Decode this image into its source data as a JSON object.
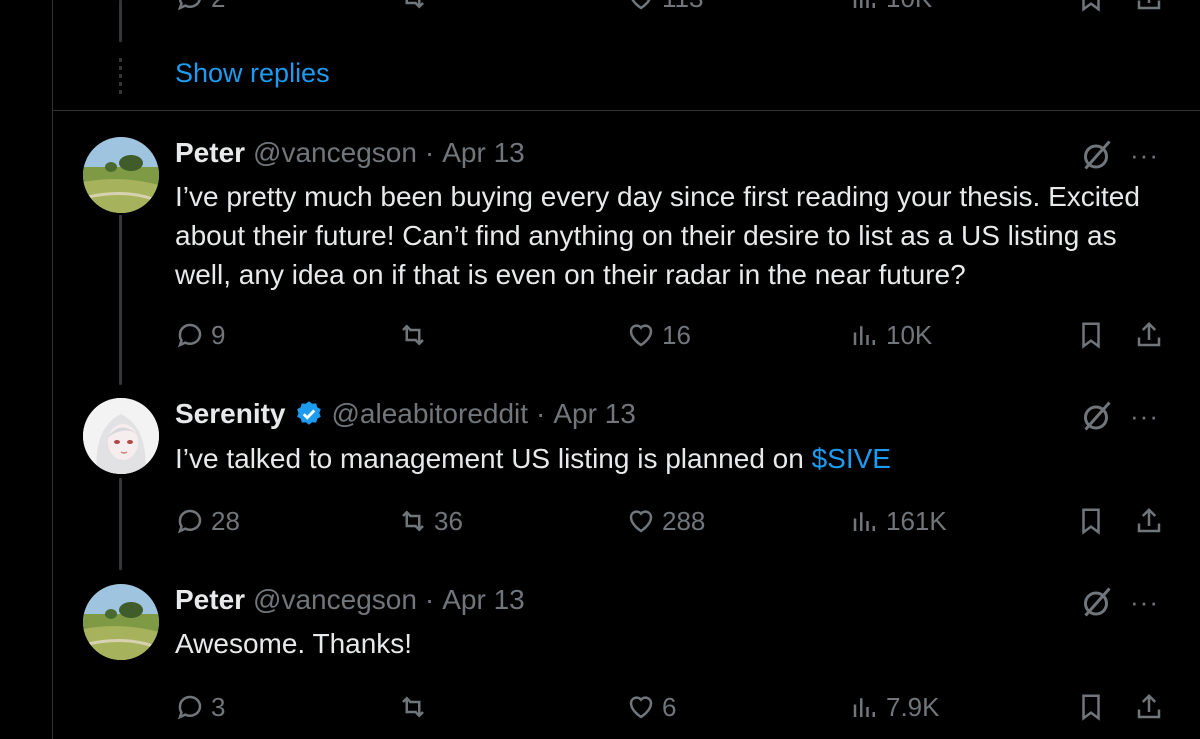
{
  "top_actions": {
    "replies": "2",
    "likes": "113",
    "views": "10K"
  },
  "show_replies": "Show replies",
  "tweets": [
    {
      "name": "Peter",
      "handle": "@vancegson",
      "separator": "·",
      "date": "Apr 13",
      "text": "I’ve pretty much been buying every day since first reading your thesis. Excited about their future! Can’t find anything on their desire to list as a US listing as well, any idea on if that is even on their radar in the near future?",
      "replies": "9",
      "reposts": "",
      "likes": "16",
      "views": "10K"
    },
    {
      "name": "Serenity",
      "handle": "@aleabitoreddit",
      "separator": "·",
      "date": "Apr 13",
      "text": "I’ve talked to management US listing is planned on ",
      "cashtag": "$SIVE",
      "replies": "28",
      "reposts": "36",
      "likes": "288",
      "views": "161K"
    },
    {
      "name": "Peter",
      "handle": "@vancegson",
      "separator": "·",
      "date": "Apr 13",
      "text": "Awesome. Thanks!",
      "replies": "3",
      "reposts": "",
      "likes": "6",
      "views": "7.9K"
    }
  ],
  "more_label": "···",
  "colors": {
    "background": "#000000",
    "text": "#e7e9ea",
    "muted": "#71767b",
    "link": "#1d9bf0",
    "divider": "#2f3336"
  }
}
